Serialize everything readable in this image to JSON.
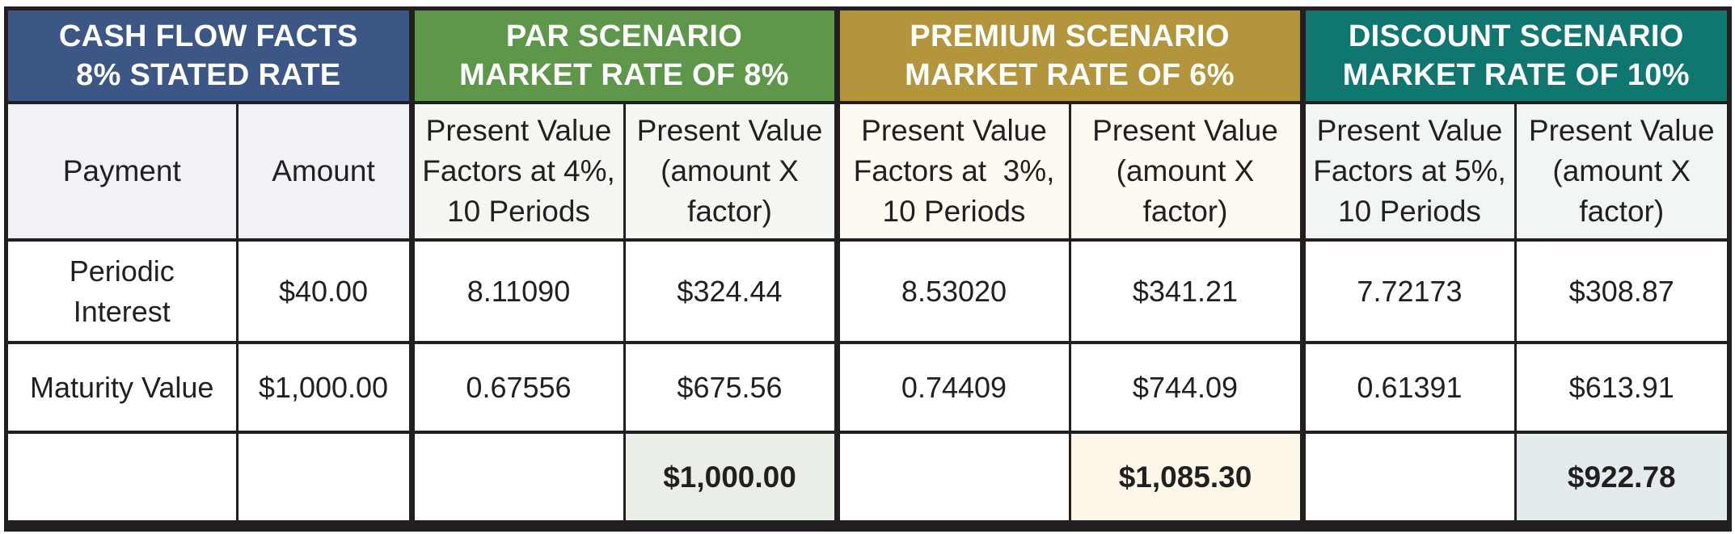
{
  "colors": {
    "cash_flow_header": "#3c5686",
    "par_header": "#5e964a",
    "premium_header": "#b3953c",
    "discount_header": "#107670",
    "cash_flow_subheader_bg": "#f1f2f5",
    "par_subheader_bg": "#f4f6f1",
    "premium_subheader_bg": "#fdfaf2",
    "discount_subheader_bg": "#f1f5f5",
    "par_total_bg": "#e9efe6",
    "premium_total_bg": "#fdf7ea",
    "discount_total_bg": "#e4ebec",
    "border": "#231f20",
    "text": "#231f20"
  },
  "groups": {
    "cash_flow": {
      "line1": "CASH FLOW FACTS",
      "line2": "8% STATED RATE"
    },
    "par": {
      "line1": "PAR SCENARIO",
      "line2": "MARKET RATE OF 8%"
    },
    "premium": {
      "line1": "PREMIUM SCENARIO",
      "line2": "MARKET RATE OF 6%"
    },
    "discount": {
      "line1": "DISCOUNT SCENARIO",
      "line2": "MARKET RATE OF 10%"
    }
  },
  "column_headers": {
    "payment": "Payment",
    "amount": "Amount",
    "par_factor": [
      "Present Value",
      "Factors at 4%,",
      "10 Periods"
    ],
    "par_pv": [
      "Present Value",
      "(amount X",
      "factor)"
    ],
    "premium_factor": [
      "Present Value",
      "Factors at  3%,",
      "10 Periods"
    ],
    "premium_pv": [
      "Present Value",
      "(amount X",
      "factor)"
    ],
    "discount_factor": [
      "Present Value",
      "Factors at 5%,",
      "10 Periods"
    ],
    "discount_pv": [
      "Present Value",
      "(amount X",
      "factor)"
    ]
  },
  "rows": {
    "periodic_interest": {
      "payment": [
        "Periodic",
        "Interest"
      ],
      "amount": "$40.00",
      "par_factor": "8.11090",
      "par_pv": "$324.44",
      "premium_factor": "8.53020",
      "premium_pv": "$341.21",
      "discount_factor": "7.72173",
      "discount_pv": "$308.87"
    },
    "maturity_value": {
      "payment": "Maturity Value",
      "amount": "$1,000.00",
      "par_factor": "0.67556",
      "par_pv": "$675.56",
      "premium_factor": "0.74409",
      "premium_pv": "$744.09",
      "discount_factor": "0.61391",
      "discount_pv": "$613.91"
    },
    "totals": {
      "par_total": "$1,000.00",
      "premium_total": "$1,085.30",
      "discount_total": "$922.78"
    }
  }
}
